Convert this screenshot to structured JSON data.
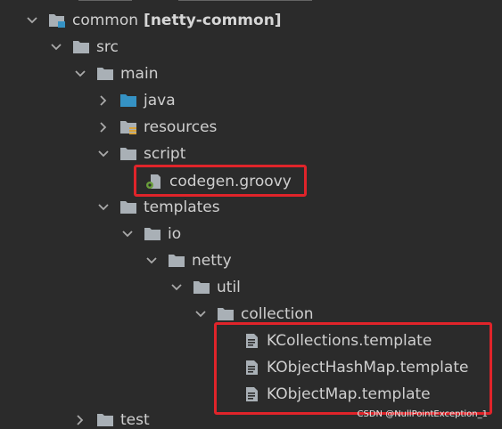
{
  "tree": {
    "module": {
      "name": "common",
      "qualifier": "[netty-common]"
    },
    "src": "src",
    "main": "main",
    "java": "java",
    "resources": "resources",
    "script": "script",
    "codegen": "codegen.groovy",
    "templates": "templates",
    "io": "io",
    "netty": "netty",
    "util": "util",
    "collection": "collection",
    "files": [
      "KCollections.template",
      "KObjectHashMap.template",
      "KObjectMap.template"
    ],
    "test": "test"
  },
  "watermark": "CSDN @NullPointException_1",
  "colors": {
    "background": "#2b2b2b",
    "text": "#cfcfcf",
    "folder": "#a9b0b6",
    "java_folder": "#3592c4",
    "highlight_border": "#e0242a"
  },
  "icons": {
    "chevron_expanded": "chevron-down-icon",
    "chevron_collapsed": "chevron-right-icon",
    "folder": "folder-icon",
    "module": "module-icon",
    "source_folder": "source-folder-icon",
    "resources_folder": "resources-folder-icon",
    "groovy_file": "groovy-file-icon",
    "template_file": "template-file-icon"
  }
}
